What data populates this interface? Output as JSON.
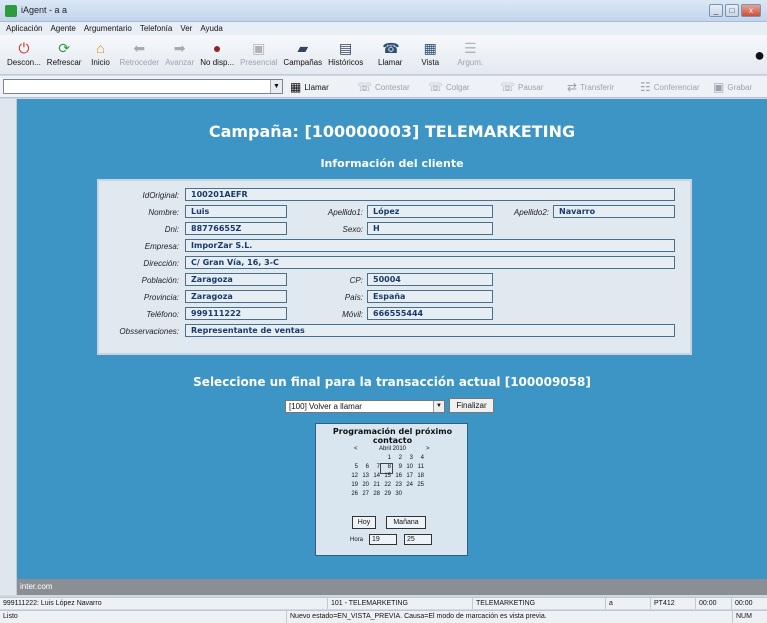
{
  "window": {
    "title": "iAgent - a a"
  },
  "menu": [
    "Aplicación",
    "Agente",
    "Argumentario",
    "Telefonía",
    "Ver",
    "Ayuda"
  ],
  "toolbar": [
    {
      "label": "Descon...",
      "icon": "power-icon",
      "enabled": true
    },
    {
      "label": "Refrescar",
      "icon": "refresh-icon",
      "enabled": true
    },
    {
      "label": "Inicio",
      "icon": "home-icon",
      "enabled": true
    },
    {
      "label": "Retroceder",
      "icon": "back-arrow-icon",
      "enabled": false
    },
    {
      "label": "Avanzar",
      "icon": "forward-arrow-icon",
      "enabled": false
    },
    {
      "label": "No disp...",
      "icon": "user-icon",
      "enabled": true
    },
    {
      "label": "Presencial",
      "icon": "presence-icon",
      "enabled": false
    },
    {
      "label": "Campañas",
      "icon": "folder-icon",
      "enabled": true
    },
    {
      "label": "Históricos",
      "icon": "document-icon",
      "enabled": true
    },
    {
      "label": "Llamar",
      "icon": "phone-icon",
      "enabled": true
    },
    {
      "label": "Vista",
      "icon": "view-icon",
      "enabled": true
    },
    {
      "label": "Argum.",
      "icon": "list-icon",
      "enabled": false
    }
  ],
  "phonebar": [
    {
      "label": "Llamar",
      "icon": "dialpad-icon",
      "enabled": true
    },
    {
      "label": "Contestar",
      "icon": "answer-phone-icon",
      "enabled": false
    },
    {
      "label": "Colgar",
      "icon": "hangup-icon",
      "enabled": false
    },
    {
      "label": "Pausar",
      "icon": "pause-phone-icon",
      "enabled": false
    },
    {
      "label": "Transferir",
      "icon": "transfer-icon",
      "enabled": false
    },
    {
      "label": "Conferenciar",
      "icon": "conference-icon",
      "enabled": false
    },
    {
      "label": "Grabar",
      "icon": "record-icon",
      "enabled": false
    }
  ],
  "main": {
    "campaign_title": "Campaña: [100000003] TELEMARKETING",
    "subtitle": "Información del cliente",
    "fields": {
      "idoriginal": {
        "label": "IdOriginal:",
        "value": "100201AEFR"
      },
      "nombre": {
        "label": "Nombre:",
        "value": "Luis"
      },
      "apellido1": {
        "label": "Apellido1:",
        "value": "López"
      },
      "apellido2": {
        "label": "Apellido2:",
        "value": "Navarro"
      },
      "dni": {
        "label": "Dni:",
        "value": "88776655Z"
      },
      "sexo": {
        "label": "Sexo:",
        "value": "H"
      },
      "empresa": {
        "label": "Empresa:",
        "value": "ImporZar S.L."
      },
      "direccion": {
        "label": "Dirección:",
        "value": "C/ Gran Vía, 16, 3-C"
      },
      "poblacion": {
        "label": "Población:",
        "value": "Zaragoza"
      },
      "cp": {
        "label": "CP:",
        "value": "50004"
      },
      "provincia": {
        "label": "Provincia:",
        "value": "Zaragoza"
      },
      "pais": {
        "label": "País:",
        "value": "España"
      },
      "telefono": {
        "label": "Teléfono:",
        "value": "999111222"
      },
      "movil": {
        "label": "Móvil:",
        "value": "666555444"
      },
      "observaciones": {
        "label": "Obsservaciones:",
        "value": "Representante de ventas"
      }
    },
    "select_title": "Seleccione un final para la transacción actual [100009058]",
    "final_select": "[100] Volver a llamar",
    "finalize_button": "Finalizar",
    "calendar": {
      "title": "Programación del próximo contacto",
      "prev": "<",
      "next": ">",
      "month": "Abril 2010",
      "weeks": [
        [
          "",
          "",
          "",
          "1",
          "2",
          "3",
          "4"
        ],
        [
          "5",
          "6",
          "7",
          "8",
          "9",
          "10",
          "11"
        ],
        [
          "12",
          "13",
          "14",
          "15",
          "16",
          "17",
          "18"
        ],
        [
          "19",
          "20",
          "21",
          "22",
          "23",
          "24",
          "25"
        ],
        [
          "26",
          "27",
          "28",
          "29",
          "30",
          "",
          ""
        ]
      ],
      "selected_day": "8",
      "today_button": "Hoy",
      "tomorrow_button": "Mañana",
      "hour_label": "Hora",
      "hour": "19",
      "minute": "25"
    }
  },
  "footer": {
    "site": "inter.com"
  },
  "status1": [
    "999111222: Luis López Navarro",
    "101 - TELEMARKETING",
    "TELEMARKETING",
    "a",
    "PT412",
    "00:00",
    "00:00"
  ],
  "status2": {
    "left": "Listo",
    "message": "Nuevo estado=EN_VISTA_PREVIA. Causa=El modo de marcación es vista previa.",
    "num": "NUM"
  }
}
